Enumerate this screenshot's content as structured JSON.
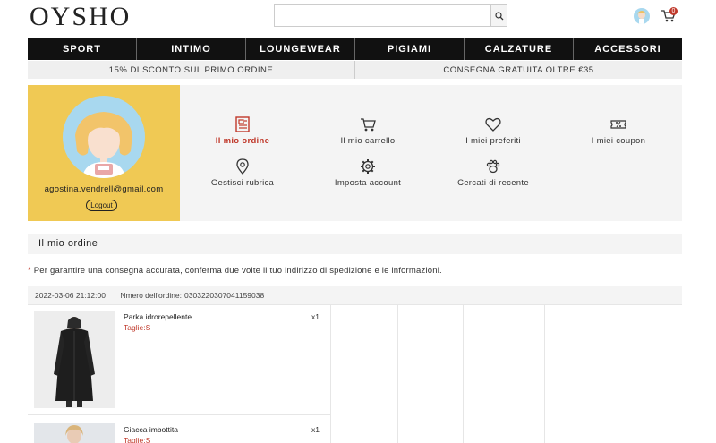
{
  "header": {
    "logo": "OYSHO",
    "search": {
      "value": "",
      "placeholder": ""
    },
    "cart_count": "0"
  },
  "nav": [
    "SPORT",
    "INTIMO",
    "LOUNGEWEAR",
    "PIGIAMI",
    "CALZATURE",
    "ACCESSORI"
  ],
  "promo": [
    "15% DI SCONTO SUL PRIMO ORDINE",
    "CONSEGNA GRATUITA OLTRE €35"
  ],
  "profile": {
    "email": "agostina.vendrell@gmail.com",
    "logout": "Logout"
  },
  "menu": [
    {
      "label": "Il mio ordine",
      "icon": "order-icon",
      "active": true
    },
    {
      "label": "Il mio carrello",
      "icon": "cart-icon",
      "active": false
    },
    {
      "label": "I miei preferiti",
      "icon": "heart-icon",
      "active": false
    },
    {
      "label": "I miei coupon",
      "icon": "coupon-icon",
      "active": false
    },
    {
      "label": "Gestisci rubrica",
      "icon": "location-pin-icon",
      "active": false
    },
    {
      "label": "Imposta account",
      "icon": "gear-icon",
      "active": false
    },
    {
      "label": "Cercati di recente",
      "icon": "paw-icon",
      "active": false
    }
  ],
  "section_title": "Il mio ordine",
  "notice": {
    "star": "*",
    "text": " Per garantire una consegna accurata, conferma due volte il tuo indirizzo di spedizione e le informazioni."
  },
  "order": {
    "date": "2022-03-06 21:12:00",
    "number_label": "Nmero dell'ordine:",
    "number": "0303220307041159038",
    "items": [
      {
        "name": "Parka idrorepellente",
        "size": "Taglie:S",
        "qty": "x1"
      },
      {
        "name": "Giacca imbottita",
        "size": "Taglie:S",
        "qty": "x1"
      }
    ]
  },
  "colors": {
    "accent": "#c0392b",
    "profile_bg": "#f0c954",
    "nav_bg": "#111111",
    "panel_bg": "#f4f4f4"
  }
}
